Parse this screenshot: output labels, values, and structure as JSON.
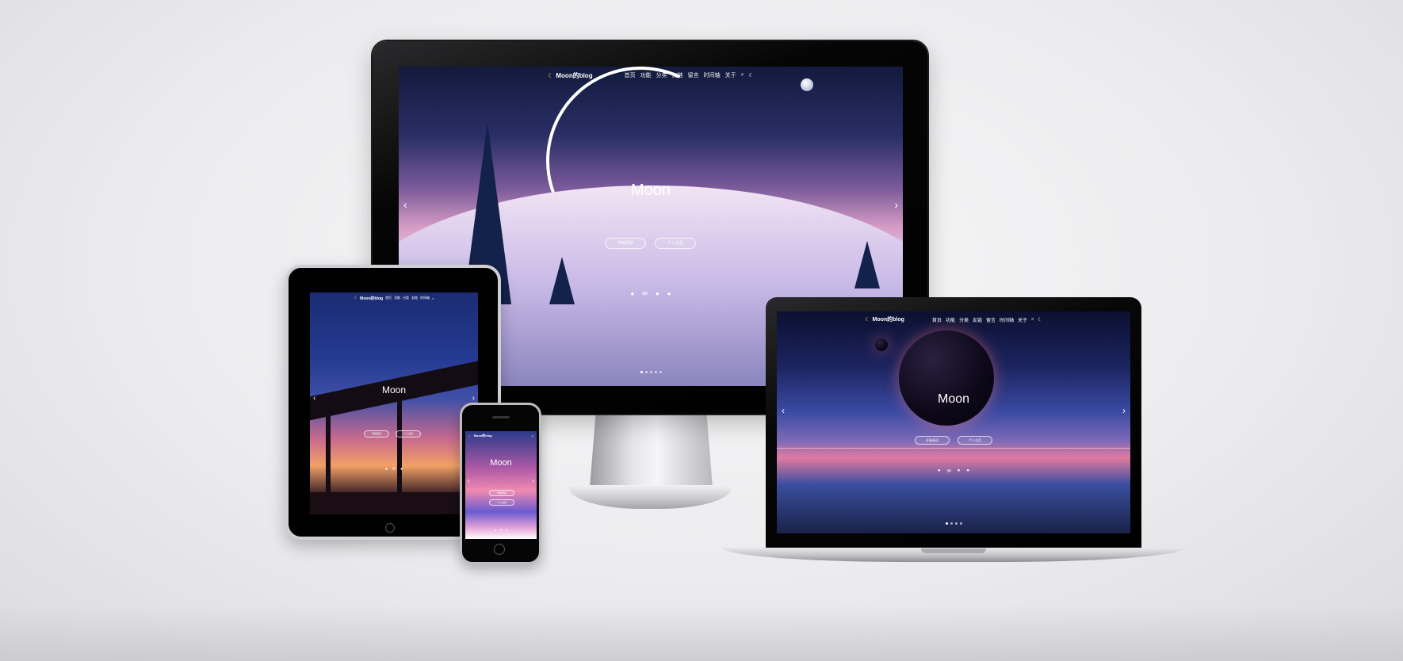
{
  "site": {
    "logo_text": "Moon的blog",
    "nav": [
      "首页",
      "功能",
      "分类",
      "友链",
      "留言",
      "时间轴",
      "关于"
    ],
    "hero_title": "Moon",
    "buttons": {
      "start": "开始阅读",
      "home": "个人主页"
    },
    "tablet_logo": "Moon的blog",
    "phone_logo": "Moon的blog"
  },
  "icons": {
    "moon": "crescent-moon-icon",
    "search": "search-icon",
    "theme": "theme-toggle-icon",
    "prev": "chevron-left-icon",
    "next": "chevron-right-icon",
    "socials": [
      "github-icon",
      "mail-icon",
      "qq-icon",
      "wechat-icon"
    ]
  },
  "colors": {
    "accent": "#f6d64a",
    "text": "#ffffff"
  }
}
